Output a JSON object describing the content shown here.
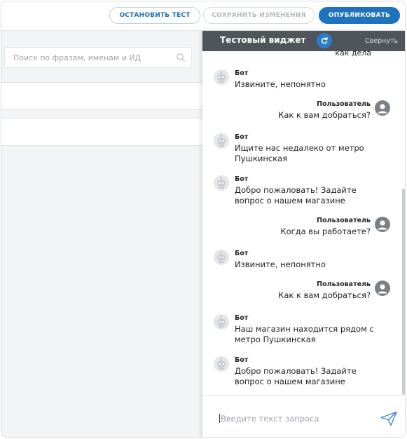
{
  "toolbar": {
    "stop_label": "ОСТАНОВИТЬ ТЕСТ",
    "save_label": "СОХРАНИТЬ ИЗМЕНЕНИЯ",
    "publish_label": "ОПУБЛИКОВАТЬ"
  },
  "search": {
    "placeholder": "Поиск по фразам, именам и ИД",
    "icon": "search-icon"
  },
  "widget": {
    "title": "Тестовый виджет",
    "refresh_icon": "refresh-icon",
    "collapse_label": "Свернуть",
    "clipped_text": "как дела",
    "input_placeholder": "Введите текст запроса",
    "send_icon": "send-icon",
    "messages": [
      {
        "sender": "Бот",
        "text": "Извините, непонятно"
      },
      {
        "sender": "Пользователь",
        "text": "Как к вам добраться?"
      },
      {
        "sender": "Бот",
        "text": "Ищите нас недалеко от метро Пушкинская"
      },
      {
        "sender": "Бот",
        "text": "Добро пожаловать! Задайте вопрос о нашем магазине"
      },
      {
        "sender": "Пользователь",
        "text": "Когда вы работаете?"
      },
      {
        "sender": "Бот",
        "text": "Извините, непонятно"
      },
      {
        "sender": "Пользователь",
        "text": "Как к вам добраться?"
      },
      {
        "sender": "Бот",
        "text": "Наш магазин находится рядом с метро Пушкинская"
      },
      {
        "sender": "Бот",
        "text": "Добро пожаловать! Задайте вопрос о нашем магазине"
      }
    ]
  },
  "colors": {
    "accent": "#1f72bd",
    "header": "#4f555b"
  }
}
